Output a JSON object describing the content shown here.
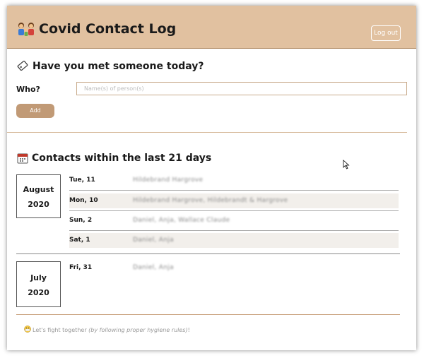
{
  "app": {
    "title": "Covid Contact Log",
    "logout_label": "Log out"
  },
  "form": {
    "title": "Have you met someone today?",
    "who_label": "Who?",
    "who_placeholder": "Name(s) of person(s)",
    "add_label": "Add"
  },
  "contacts": {
    "title": "Contacts within the last 21 days",
    "months": [
      {
        "month": "August",
        "year": "2020",
        "rows": [
          {
            "day": "Tue, 11",
            "names": "Hildebrand Hargrove"
          },
          {
            "day": "Mon, 10",
            "names": "Hildebrand Hargrove, Hildebrandt & Hargrove"
          },
          {
            "day": "Sun, 2",
            "names": "Daniel, Anja, Wallace Claude"
          },
          {
            "day": "Sat, 1",
            "names": "Daniel, Anja"
          }
        ]
      },
      {
        "month": "July",
        "year": "2020",
        "rows": [
          {
            "day": "Fri, 31",
            "names": "Daniel, Anja"
          }
        ]
      }
    ]
  },
  "footer": {
    "text": "Let's fight together",
    "italic": "(by following proper hygiene rules)",
    "end": "!"
  },
  "colors": {
    "header_bg": "#e1c1a0",
    "accent": "#c19a76"
  }
}
